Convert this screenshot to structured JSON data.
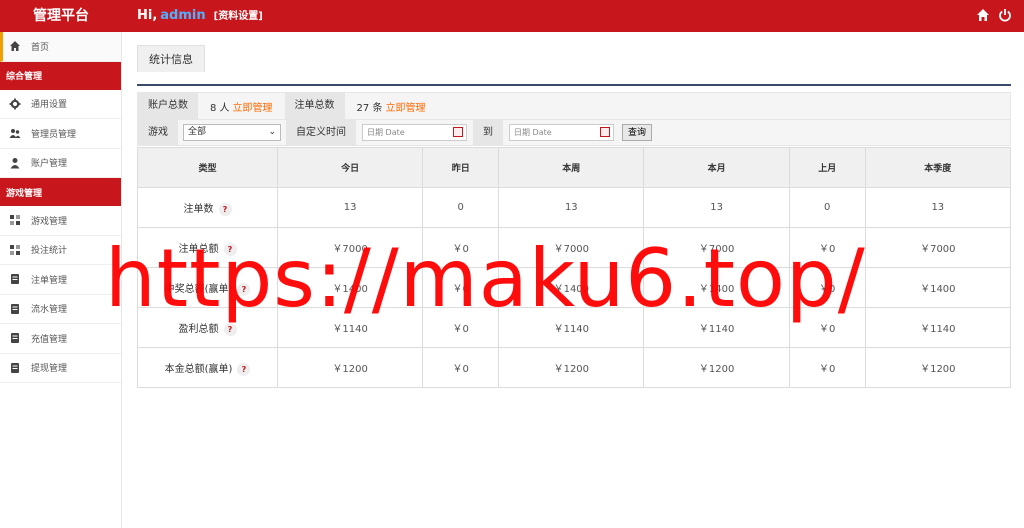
{
  "header": {
    "brand": "管理平台",
    "greeting": "Hi,",
    "username": "admin",
    "profile_link": "[资料设置]",
    "icons": [
      "home-icon",
      "power-icon"
    ]
  },
  "sidebar": {
    "home": "首页",
    "group1": "综合管理",
    "group1_items": [
      "通用设置",
      "管理员管理",
      "账户管理"
    ],
    "group2": "游戏管理",
    "group2_items": [
      "游戏管理",
      "投注统计",
      "注单管理",
      "流水管理",
      "充值管理",
      "提现管理"
    ]
  },
  "tab": {
    "label": "统计信息"
  },
  "stats": {
    "accounts_label": "账户总数",
    "accounts_value": "8 人",
    "accounts_link": "立即管理",
    "orders_label": "注单总数",
    "orders_value": "27 条",
    "orders_link": "立即管理"
  },
  "filter": {
    "game_label": "游戏",
    "game_value": "全部",
    "custom_time_label": "自定义时间",
    "date_placeholder_from": "日期 Date",
    "to_label": "到",
    "date_placeholder_to": "日期 Date",
    "query_button": "查询"
  },
  "table": {
    "headers": [
      "类型",
      "今日",
      "昨日",
      "本周",
      "本月",
      "上月",
      "本季度"
    ],
    "rows": [
      {
        "type": "注单数",
        "values": [
          "13",
          "0",
          "13",
          "13",
          "0",
          "13"
        ]
      },
      {
        "type": "注单总额",
        "values": [
          "￥7000",
          "￥0",
          "￥7000",
          "￥7000",
          "￥0",
          "￥7000"
        ]
      },
      {
        "type": "中奖总额(赢单)",
        "values": [
          "￥1400",
          "￥0",
          "￥1400",
          "￥1400",
          "￥0",
          "￥1400"
        ]
      },
      {
        "type": "盈利总额",
        "values": [
          "￥1140",
          "￥0",
          "￥1140",
          "￥1140",
          "￥0",
          "￥1140"
        ]
      },
      {
        "type": "本金总额(赢单)",
        "values": [
          "￥1200",
          "￥0",
          "￥1200",
          "￥1200",
          "￥0",
          "￥1200"
        ]
      }
    ]
  },
  "watermark": "https://maku6.top/"
}
